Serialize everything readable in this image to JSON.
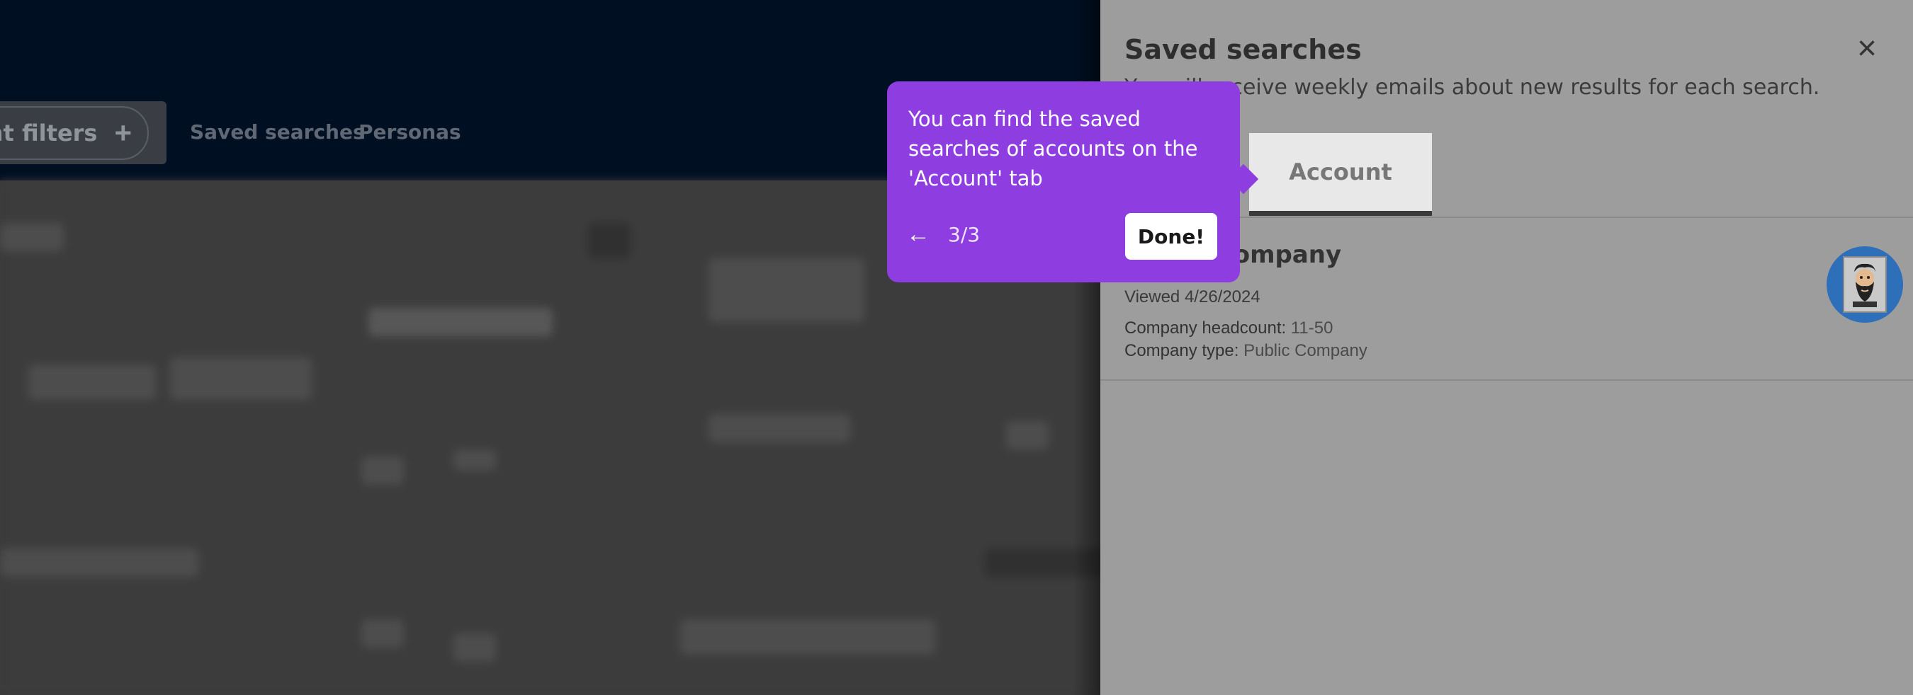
{
  "header": {
    "filters_label": "unt filters",
    "filters_plus": "+",
    "links": [
      "Saved searches",
      "Personas"
    ]
  },
  "drawer": {
    "title": "Saved searches",
    "subtitle": "You will receive weekly emails about new results for each search.",
    "close_icon": "×",
    "tabs": [
      "Account"
    ],
    "result": {
      "name": "Public Company",
      "viewed": "Viewed 4/26/2024",
      "headcount_label": "Company headcount:",
      "headcount_value": "11-50",
      "type_label": "Company type:",
      "type_value": "Public Company"
    }
  },
  "tour": {
    "text": "You can find the saved searches of accounts on the 'Account' tab",
    "back_icon": "←",
    "progress": "3/3",
    "done_label": "Done!"
  },
  "colors": {
    "header_bg": "#000f22",
    "tour_bg": "#8e3de0",
    "drawer_bg": "#9d9d9d"
  }
}
